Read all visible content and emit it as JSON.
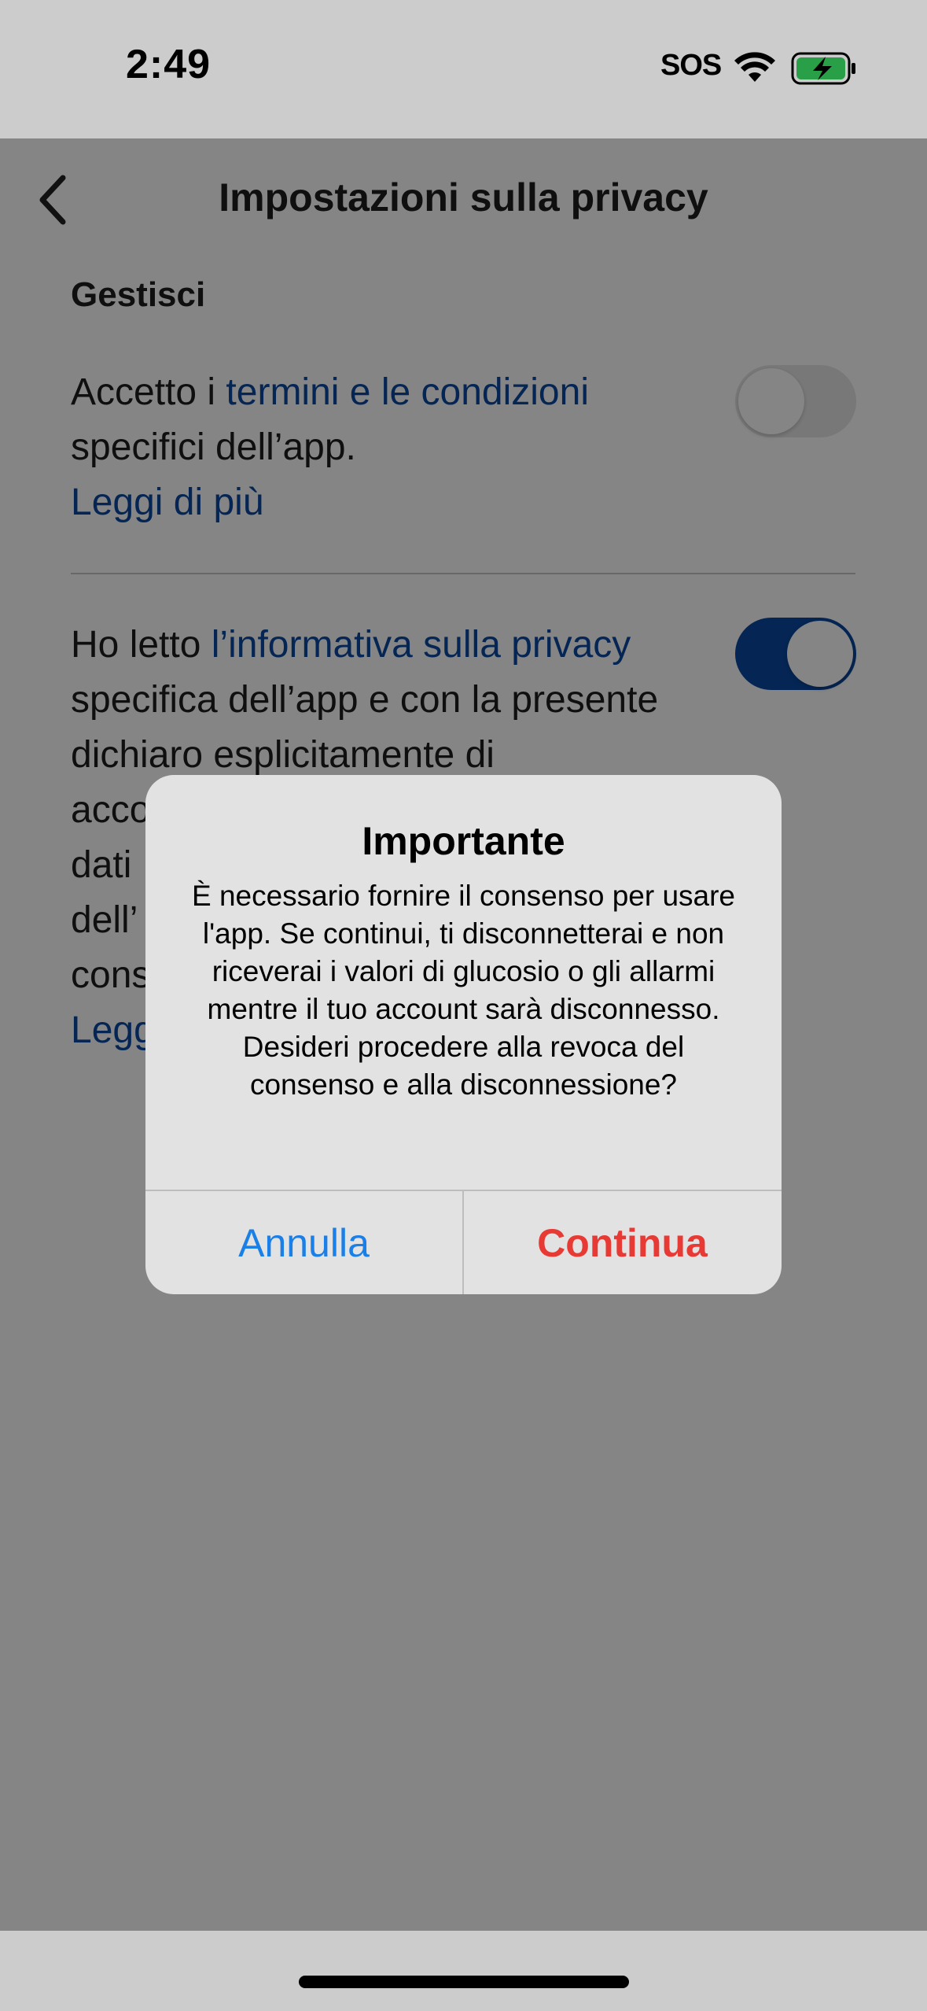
{
  "status_bar": {
    "time": "2:49",
    "sos": "SOS",
    "icons": [
      "wifi-icon",
      "battery-charging-icon"
    ]
  },
  "nav": {
    "back_icon": "chevron-left-icon",
    "title": "Impostazioni sulla privacy"
  },
  "section": {
    "heading": "Gestisci"
  },
  "items": [
    {
      "text_before": "Accetto i ",
      "link": "termini e le condizioni",
      "text_after": " specifici dell’app.",
      "read_more": "Leggi di più",
      "toggle_on": false
    },
    {
      "text_before": "Ho letto ",
      "link": "l’informativa sulla privacy",
      "text_after": " specifica dell’app e con la presente dichiaro esplicitamente di",
      "lines_partial": [
        "acco",
        "dati",
        "dell’",
        "cons"
      ],
      "read_more": "Legg",
      "toggle_on": true
    }
  ],
  "alert": {
    "title": "Importante",
    "message": "È necessario fornire il consenso per usare l'app. Se continui, ti disconnetterai e non riceverai i valori di glucosio o gli allarmi mentre il tuo account sarà disconnesso. Desideri procedere alla revoca del consenso e alla disconnessione?",
    "cancel_label": "Annulla",
    "continue_label": "Continua"
  },
  "colors": {
    "link": "#0a4aa3",
    "toggle_on": "#0a4aa3",
    "alert_cancel": "#1a7fe6",
    "alert_continue": "#e83a35"
  }
}
